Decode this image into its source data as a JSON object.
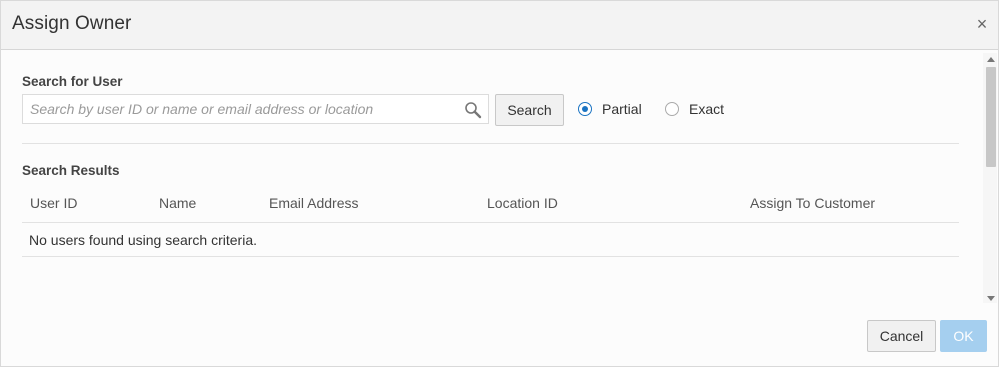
{
  "dialog": {
    "title": "Assign Owner",
    "close_glyph": "×"
  },
  "search": {
    "section_label": "Search for User",
    "placeholder": "Search by user ID or name or email address or location",
    "value": "",
    "button_label": "Search",
    "icon": "magnifier-icon",
    "match_options": [
      {
        "label": "Partial",
        "selected": true
      },
      {
        "label": "Exact",
        "selected": false
      }
    ]
  },
  "results": {
    "section_label": "Search Results",
    "columns": [
      "User ID",
      "Name",
      "Email Address",
      "Location ID",
      "Assign To Customer"
    ],
    "empty_message": "No users found using search criteria."
  },
  "footer": {
    "cancel_label": "Cancel",
    "ok_label": "OK"
  },
  "colors": {
    "accent": "#1a73c2",
    "ok_disabled_bg": "#a5cfef",
    "titlebar_bg": "#f3f3f3"
  }
}
